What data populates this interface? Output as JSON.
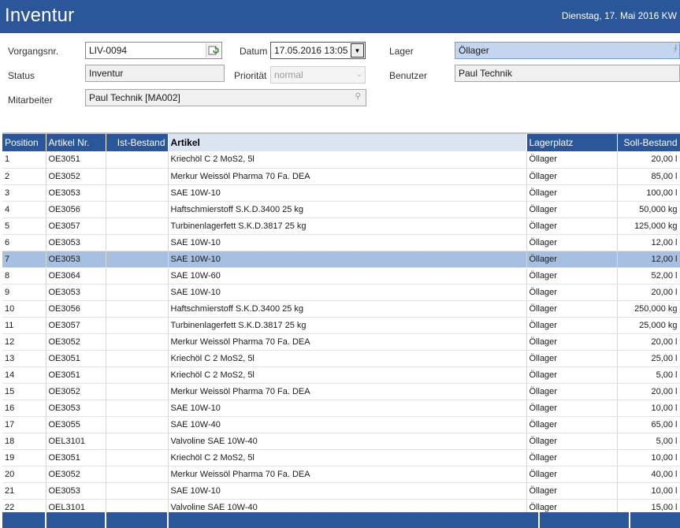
{
  "window": {
    "title": "Inventur",
    "date": "Dienstag, 17. Mai 2016  KW"
  },
  "form": {
    "vorgangsnr_label": "Vorgangsnr.",
    "vorgangsnr_value": "LIV-0094",
    "status_label": "Status",
    "status_value": "Inventur",
    "mitarbeiter_label": "Mitarbeiter",
    "mitarbeiter_value": "Paul Technik [MA002]",
    "datum_label": "Datum",
    "datum_value": "17.05.2016 13:05",
    "prioritaet_label": "Priorität",
    "prioritaet_value": "normal",
    "lager_label": "Lager",
    "lager_value": "Öllager",
    "benutzer_label": "Benutzer",
    "benutzer_value": "Paul Technik"
  },
  "table": {
    "columns": [
      "Position",
      "Artikel Nr.",
      "Ist-Bestand",
      "Artikel",
      "Lagerplatz",
      "Soll-Bestand"
    ],
    "selected_row": 7,
    "rows": [
      [
        "1",
        "OE3051",
        "",
        "Kriechöl C 2 MoS2, 5l",
        "Öllager",
        "20,00 l"
      ],
      [
        "2",
        "OE3052",
        "",
        "Merkur Weissöl Pharma 70 Fa. DEA",
        "Öllager",
        "85,00 l"
      ],
      [
        "3",
        "OE3053",
        "",
        "SAE 10W-10",
        "Öllager",
        "100,00 l"
      ],
      [
        "4",
        "OE3056",
        "",
        "Haftschmierstoff S.K.D.3400 25 kg",
        "Öllager",
        "50,000 kg"
      ],
      [
        "5",
        "OE3057",
        "",
        "Turbinenlagerfett S.K.D.3817 25 kg",
        "Öllager",
        "125,000 kg"
      ],
      [
        "6",
        "OE3053",
        "",
        "SAE 10W-10",
        "Öllager",
        "12,00 l"
      ],
      [
        "7",
        "OE3053",
        "",
        "SAE 10W-10",
        "Öllager",
        "12,00 l"
      ],
      [
        "8",
        "OE3064",
        "",
        "SAE 10W-60",
        "Öllager",
        "52,00 l"
      ],
      [
        "9",
        "OE3053",
        "",
        "SAE 10W-10",
        "Öllager",
        "20,00 l"
      ],
      [
        "10",
        "OE3056",
        "",
        "Haftschmierstoff S.K.D.3400 25 kg",
        "Öllager",
        "250,000 kg"
      ],
      [
        "11",
        "OE3057",
        "",
        "Turbinenlagerfett S.K.D.3817 25 kg",
        "Öllager",
        "25,000 kg"
      ],
      [
        "12",
        "OE3052",
        "",
        "Merkur Weissöl Pharma 70 Fa. DEA",
        "Öllager",
        "20,00 l"
      ],
      [
        "13",
        "OE3051",
        "",
        "Kriechöl C 2 MoS2, 5l",
        "Öllager",
        "25,00 l"
      ],
      [
        "14",
        "OE3051",
        "",
        "Kriechöl C 2 MoS2, 5l",
        "Öllager",
        "5,00 l"
      ],
      [
        "15",
        "OE3052",
        "",
        "Merkur Weissöl Pharma 70 Fa. DEA",
        "Öllager",
        "20,00 l"
      ],
      [
        "16",
        "OE3053",
        "",
        "SAE 10W-10",
        "Öllager",
        "10,00 l"
      ],
      [
        "17",
        "OE3055",
        "",
        "SAE 10W-40",
        "Öllager",
        "65,00 l"
      ],
      [
        "18",
        "OEL3101",
        "",
        "Valvoline SAE 10W-40",
        "Öllager",
        "5,00 l"
      ],
      [
        "19",
        "OE3051",
        "",
        "Kriechöl C 2 MoS2, 5l",
        "Öllager",
        "10,00 l"
      ],
      [
        "20",
        "OE3052",
        "",
        "Merkur Weissöl Pharma 70 Fa. DEA",
        "Öllager",
        "40,00 l"
      ],
      [
        "21",
        "OE3053",
        "",
        "SAE 10W-10",
        "Öllager",
        "10,00 l"
      ],
      [
        "22",
        "OEL3101",
        "",
        "Valvoline SAE 10W-40",
        "Öllager",
        "15,00 l"
      ]
    ]
  },
  "colors": {
    "accent": "#2b579a",
    "selected_row": "#a7c0e2",
    "artikel_header": "#dbe4f1"
  }
}
